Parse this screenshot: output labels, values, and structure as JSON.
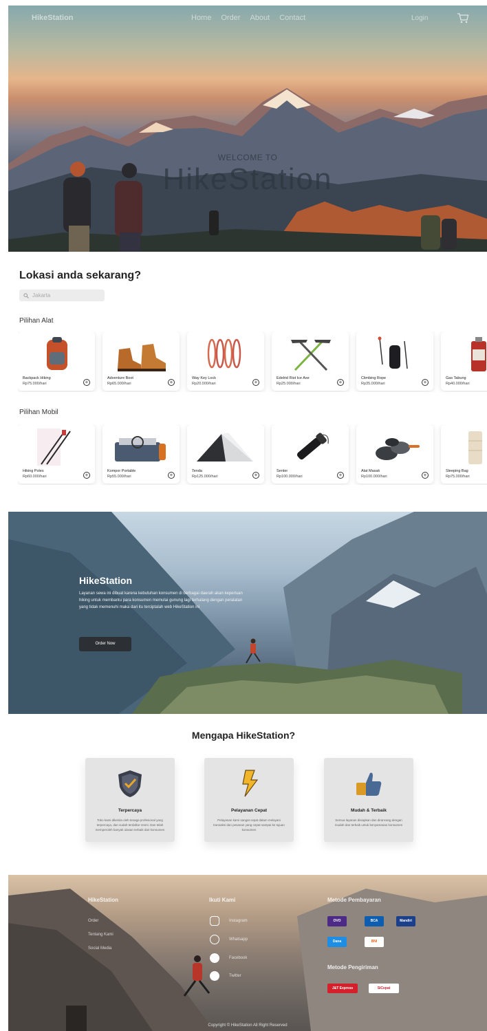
{
  "nav": {
    "brand": "HikeStation",
    "links": [
      "Home",
      "Order",
      "About",
      "Contact"
    ],
    "login": "Login"
  },
  "hero": {
    "subtitle": "WELCOME TO",
    "title": "HikeStation"
  },
  "location": {
    "heading": "Lokasi anda sekarang?",
    "search_placeholder": "Jakarta"
  },
  "equipment": {
    "label": "Pilihan Alat",
    "items": [
      {
        "name": "Backpack Hiking",
        "price": "Rp75.000/hari",
        "icon": "backpack-icon"
      },
      {
        "name": "Adventure Boot",
        "price": "Rp65.000/hari",
        "icon": "boots-icon"
      },
      {
        "name": "Way Key Lock",
        "price": "Rp20.000/hari",
        "icon": "carabiner-icon"
      },
      {
        "name": "Edelrid Rist Ice Axe",
        "price": "Rp25.000/hari",
        "icon": "ice-axe-icon"
      },
      {
        "name": "Climbing Rope",
        "price": "Rp35.000/hari",
        "icon": "rope-icon"
      },
      {
        "name": "Gas Tabung",
        "price": "Rp40.000/hari",
        "icon": "gas-canister-icon"
      }
    ]
  },
  "vehicles": {
    "label": "Pilihan Mobil",
    "items": [
      {
        "name": "Hiking Poles",
        "price": "Rp60.000/hari",
        "icon": "hiking-poles-icon"
      },
      {
        "name": "Kompor Portable",
        "price": "Rp55.000/hari",
        "icon": "stove-icon"
      },
      {
        "name": "Tenda",
        "price": "Rp125.000/hari",
        "icon": "tent-icon"
      },
      {
        "name": "Senter",
        "price": "Rp100.000/hari",
        "icon": "flashlight-icon"
      },
      {
        "name": "Alat Masak",
        "price": "Rp100.000/hari",
        "icon": "cookware-icon"
      },
      {
        "name": "Sleeping Bag",
        "price": "Rp75.000/hari",
        "icon": "sleeping-bag-icon"
      }
    ]
  },
  "about": {
    "title": "HikeStation",
    "text": "Layanan sewa ini dibuat karena kebutuhan konsumen di berbagai daerah akan keperluan hiking untuk membantu para konsumen memulai gunung lagi terhalang dengan peralatan yang tidak memenuhi maka dari itu terciptalah web HikeStation ini",
    "button": "Order Now"
  },
  "why": {
    "title": "Mengapa HikeStation?",
    "cards": [
      {
        "title": "Terpercaya",
        "desc": "Toko kami dikelola oleh tenaga profesional yang terpercaya, dan sudah terdaftar resmi. Dan telah memperoleh banyak ulasan terbaik dari konsumen",
        "icon": "shield-icon"
      },
      {
        "title": "Pelayanan Cepat",
        "desc": "Pelayanan kami sangat cepat dalam melayani transaksi dan pesanan yang cepat sampai ke tujuan konsumen",
        "icon": "lightning-icon"
      },
      {
        "title": "Mudah & Terbaik",
        "desc": "Semua layanan disiapkan dan dirancang dengan mudah dan terbaik untuk kenyamanan konsumen",
        "icon": "thumbs-up-icon"
      }
    ]
  },
  "footer": {
    "col1": {
      "heading": "HikeStation",
      "links": [
        "Order",
        "Tentang Kami",
        "Social Media"
      ]
    },
    "col2": {
      "heading": "Ikuti Kami",
      "links": [
        "Instagram",
        "Whatsapp",
        "Facebook",
        "Twitter"
      ]
    },
    "payment": {
      "heading": "Metode Pembayaran",
      "methods": [
        "OVO",
        "BCA",
        "Mandiri",
        "Dana",
        "BNI"
      ]
    },
    "shipping": {
      "heading": "Metode Pengiriman",
      "methods": [
        "J&T Express",
        "SiCepat"
      ]
    },
    "copyright": "Copyright © HikeStation All Right Reserved"
  },
  "colors": {
    "dark_button": "#2c2f33",
    "ovo": "#4c2a86",
    "bca": "#0d5eb0",
    "jnt": "#d3202a"
  }
}
